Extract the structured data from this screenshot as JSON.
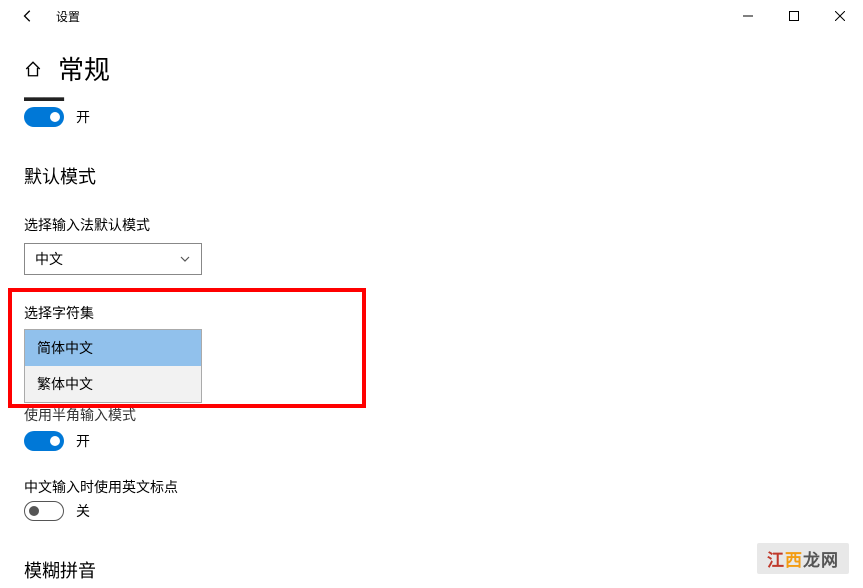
{
  "titlebar": {
    "title": "设置"
  },
  "page": {
    "title": "常规"
  },
  "truncated_section_label": "▂▂▂▂",
  "toggle1": {
    "state": "on",
    "label": "开"
  },
  "section_default_mode": {
    "title": "默认模式",
    "input_method_label": "选择输入法默认模式",
    "input_method_value": "中文",
    "charset_label": "选择字符集",
    "charset_options": {
      "simplified": "简体中文",
      "traditional": "繁体中文"
    },
    "half_full_label": "使用半角输入模式"
  },
  "toggle2": {
    "state": "on",
    "label": "开"
  },
  "punctuation_label": "中文输入时使用英文标点",
  "toggle3": {
    "state": "off",
    "label": "关"
  },
  "section_fuzzy": {
    "title": "模糊拼音"
  },
  "watermark": {
    "part1": "江",
    "part2": "西",
    "part3": "龙网"
  }
}
